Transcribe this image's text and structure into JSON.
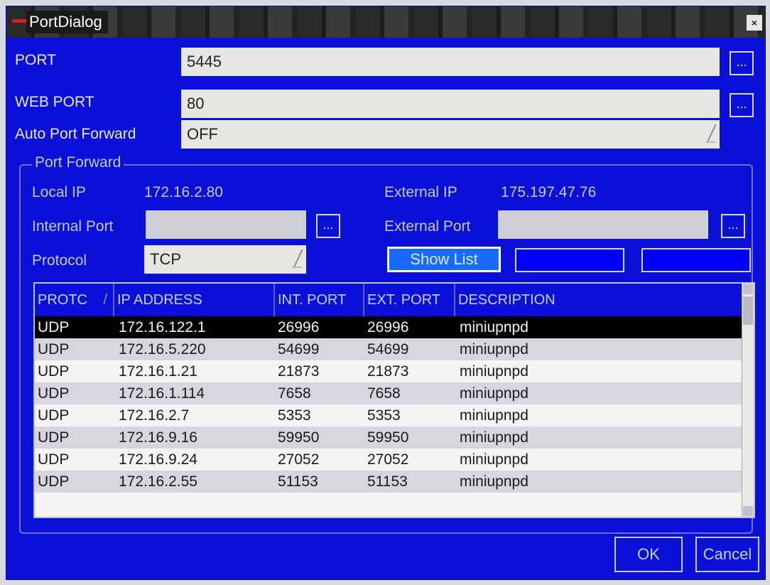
{
  "window": {
    "title": "PortDialog",
    "close": "×"
  },
  "port": {
    "label": "PORT",
    "value": "5445",
    "more": "..."
  },
  "web_port": {
    "label": "WEB PORT",
    "value": "80",
    "more": "..."
  },
  "auto_forward": {
    "label": "Auto Port Forward",
    "value": "OFF"
  },
  "port_forward": {
    "group_title": "Port Forward",
    "local_ip_label": "Local IP",
    "local_ip": "172.16.2.80",
    "external_ip_label": "External IP",
    "external_ip": "175.197.47.76",
    "internal_port_label": "Internal Port",
    "internal_port_value": "",
    "external_port_label": "External Port",
    "external_port_value": "",
    "more": "...",
    "protocol_label": "Protocol",
    "protocol_value": "TCP",
    "show_list": "Show List"
  },
  "table": {
    "columns": [
      "PROTC",
      "IP ADDRESS",
      "INT. PORT",
      "EXT. PORT",
      "DESCRIPTION"
    ],
    "rows": [
      [
        "UDP",
        "172.16.122.1",
        "26996",
        "26996",
        "miniupnpd"
      ],
      [
        "UDP",
        "172.16.5.220",
        "54699",
        "54699",
        "miniupnpd"
      ],
      [
        "UDP",
        "172.16.1.21",
        "21873",
        "21873",
        "miniupnpd"
      ],
      [
        "UDP",
        "172.16.1.114",
        "7658",
        "7658",
        "miniupnpd"
      ],
      [
        "UDP",
        "172.16.2.7",
        "5353",
        "5353",
        "miniupnpd"
      ],
      [
        "UDP",
        "172.16.9.16",
        "59950",
        "59950",
        "miniupnpd"
      ],
      [
        "UDP",
        "172.16.9.24",
        "27052",
        "27052",
        "miniupnpd"
      ],
      [
        "UDP",
        "172.16.2.55",
        "51153",
        "51153",
        "miniupnpd"
      ]
    ],
    "selected_row": 0
  },
  "buttons": {
    "ok": "OK",
    "cancel": "Cancel"
  }
}
